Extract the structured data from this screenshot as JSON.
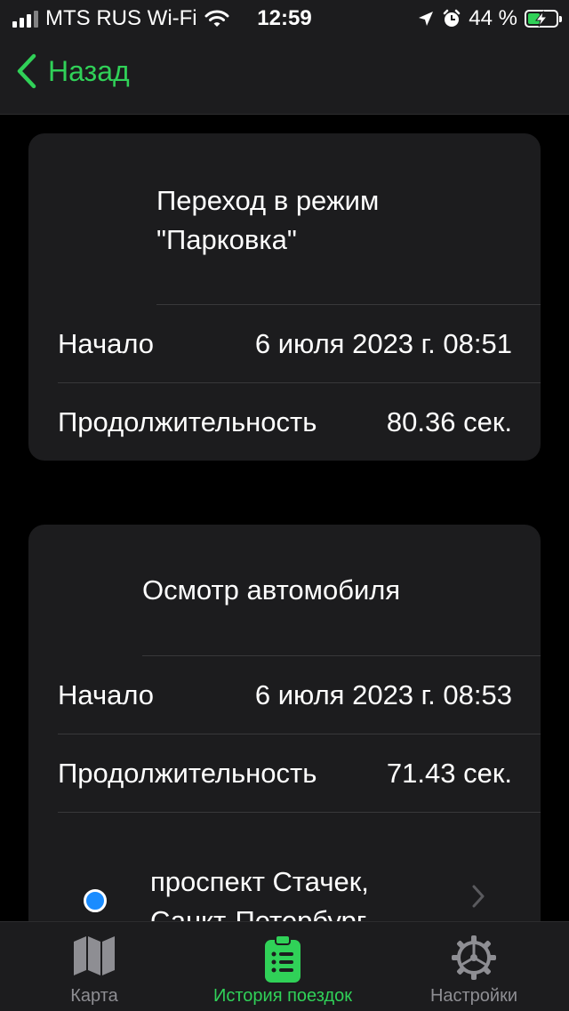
{
  "colors": {
    "accent": "#30d158",
    "inactive": "#8e8e93",
    "background": "#000000",
    "card": "#1c1c1e",
    "location_dot": "#1a8cff"
  },
  "status_bar": {
    "carrier": "MTS RUS Wi-Fi",
    "time": "12:59",
    "battery": "44 %",
    "battery_level": 0.44
  },
  "nav": {
    "back_label": "Назад"
  },
  "events": [
    {
      "title_line1": "Переход в режим",
      "title_line2": "\"Парковка\"",
      "start_label": "Начало",
      "start_value": "6 июля 2023 г.  08:51",
      "duration_label": "Продолжительность",
      "duration_value": "80.36 сек."
    },
    {
      "title": "Осмотр автомобиля",
      "start_label": "Начало",
      "start_value": "6 июля 2023 г.  08:53",
      "duration_label": "Продолжительность",
      "duration_value": "71.43 сек.",
      "address_line1": "проспект Стачек,",
      "address_line2": "Санкт-Петербург"
    }
  ],
  "tabs": [
    {
      "label": "Карта",
      "icon": "map-icon",
      "active": false
    },
    {
      "label": "История поездок",
      "icon": "clipboard-list-icon",
      "active": true
    },
    {
      "label": "Настройки",
      "icon": "gear-icon",
      "active": false
    }
  ]
}
